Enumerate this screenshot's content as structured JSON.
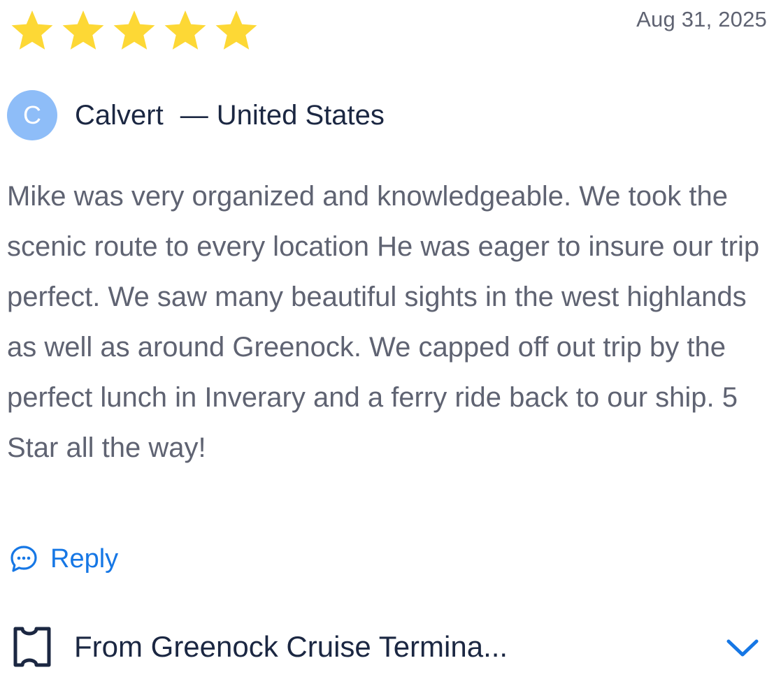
{
  "review": {
    "rating": 5,
    "rating_max": 5,
    "date": "Aug 31, 2025",
    "reviewer": {
      "avatar_letter": "C",
      "name": "Calvert",
      "separator": "—",
      "country": "United States"
    },
    "text": "Mike was very organized and knowledgeable. We took the scenic route to every location He was eager to insure our trip perfect. We saw many beautiful sights in the west highlands as well as around Greenock. We capped off out trip by the perfect lunch in Inverary and a ferry ride back to our ship. 5 Star all the way!",
    "reply_label": "Reply",
    "tour_title": "From Greenock Cruise Termina..."
  },
  "icons": {
    "star": "star-icon",
    "reply": "chat-bubble-icon",
    "tour": "ticket-icon",
    "expand": "chevron-down-icon"
  },
  "colors": {
    "star": "#FDD835",
    "accent": "#1677E5",
    "avatar_bg": "#8EBDF8",
    "heading": "#1B2742",
    "body_text": "#5F6372"
  }
}
